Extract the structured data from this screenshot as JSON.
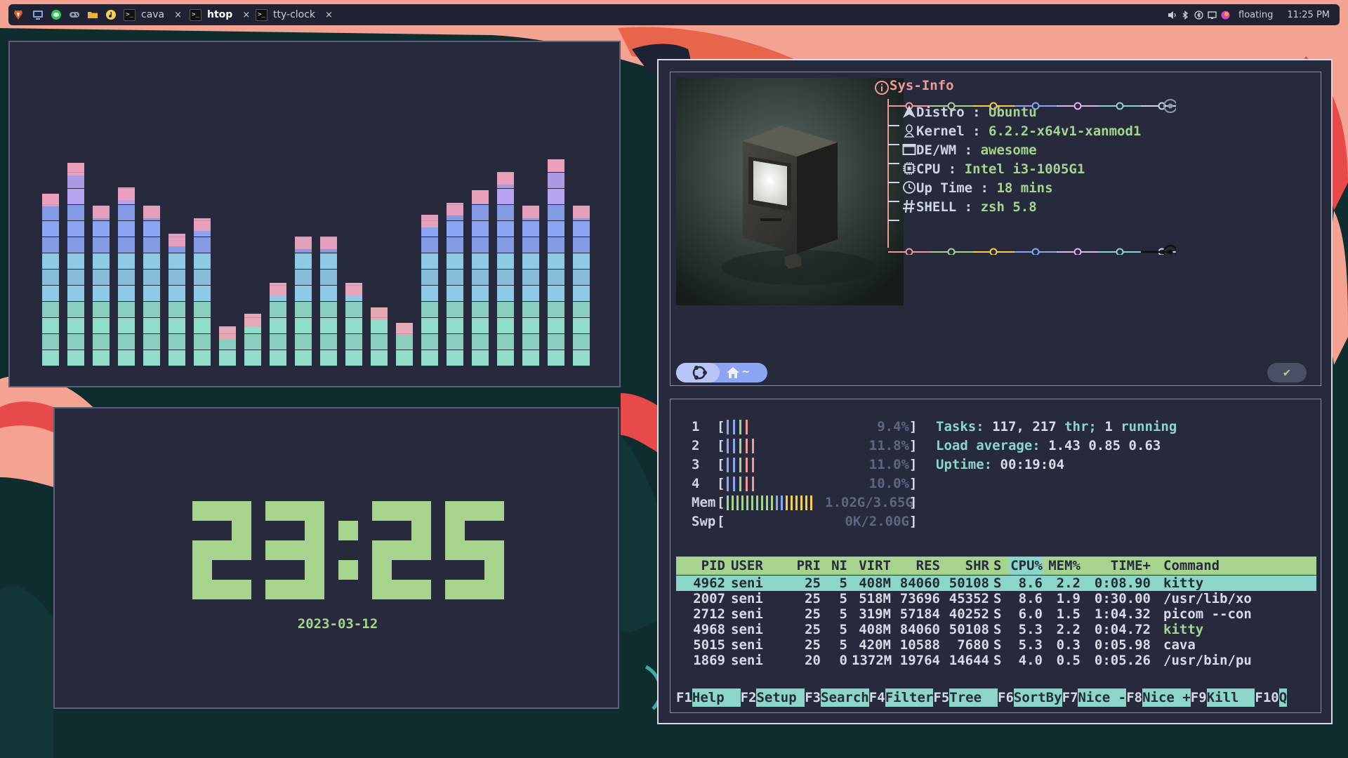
{
  "topbar": {
    "launchers": [
      {
        "icon": "brave-browser-icon",
        "color": "#e4572e"
      },
      {
        "icon": "system-monitor-icon",
        "color": "#8aa3d8"
      },
      {
        "icon": "chat-app-icon",
        "color": "#34c759"
      },
      {
        "icon": "gamepad-icon",
        "color": "#8e96b0"
      },
      {
        "icon": "folder-icon",
        "color": "#f2b233"
      },
      {
        "icon": "music-player-icon",
        "color": "#f5d04a"
      }
    ],
    "tabs": [
      {
        "label": "cava",
        "close": "×",
        "active": false
      },
      {
        "label": "htop",
        "close": "×",
        "active": true
      },
      {
        "label": "tty-clock",
        "close": "×",
        "active": false
      }
    ],
    "tray": {
      "layout": "floating",
      "time": "11:25 PM"
    }
  },
  "cava": {
    "bar_levels": [
      0.56,
      0.66,
      0.52,
      0.58,
      0.52,
      0.43,
      0.48,
      0.13,
      0.17,
      0.27,
      0.42,
      0.42,
      0.27,
      0.19,
      0.14,
      0.49,
      0.53,
      0.57,
      0.63,
      0.52,
      0.67,
      0.52
    ],
    "gradient": [
      "#f4a0b4",
      "#e3b4f0",
      "#b6a4f2",
      "#8ba4f4",
      "#8ec9e6",
      "#91dcca"
    ]
  },
  "clock": {
    "time": "23:25",
    "date": "2023-03-12",
    "digit_color": "#a6d48f"
  },
  "sysinfo": {
    "title": "Sys-Info",
    "rows": [
      {
        "icon": "arch-arrow-icon",
        "label": "Distro",
        "value": "Ubuntu"
      },
      {
        "icon": "linux-penguin-icon",
        "label": "Kernel",
        "value": "6.2.2-x64v1-xanmod1"
      },
      {
        "icon": "window-icon",
        "label": "DE/WM",
        "value": "awesome"
      },
      {
        "icon": "cpu-chip-icon",
        "label": "CPU",
        "value": "Intel i3-1005G1"
      },
      {
        "icon": "clock-icon",
        "label": "Up Time",
        "value": "18 mins"
      },
      {
        "icon": "hash-icon",
        "label": "SHELL",
        "value": "zsh 5.8"
      }
    ],
    "separator": ":",
    "dot_colors": [
      "#f19898",
      "#a6d48f",
      "#f5d04a",
      "#8ba4f4",
      "#e3b4f0",
      "#8bd5ca",
      "#cfd3e6"
    ]
  },
  "prompt": {
    "path": "~",
    "ok": "✔"
  },
  "htop": {
    "cpus": [
      {
        "id": "1",
        "percent": "9.4%",
        "bars": [
          "#8ba4f4",
          "#8ba4f4",
          "#a6d48f",
          "#f19898"
        ]
      },
      {
        "id": "2",
        "percent": "11.8%",
        "bars": [
          "#8ba4f4",
          "#8ba4f4",
          "#a6d48f",
          "#f19898",
          "#f19898"
        ]
      },
      {
        "id": "3",
        "percent": "11.0%",
        "bars": [
          "#8ba4f4",
          "#8ba4f4",
          "#a6d48f",
          "#f19898",
          "#f19898"
        ]
      },
      {
        "id": "4",
        "percent": "10.0%",
        "bars": [
          "#8ba4f4",
          "#8ba4f4",
          "#a6d48f",
          "#f19898",
          "#f19898"
        ]
      }
    ],
    "mem": {
      "label": "Mem",
      "value": "1.02G/3.65G",
      "bars": 18
    },
    "swp": {
      "label": "Swp",
      "value": "0K/2.00G"
    },
    "open_bracket": "[",
    "close_bracket": "]",
    "tasks_label": "Tasks:",
    "tasks_value": "117,",
    "threads_value": "217",
    "threads_label": "thr;",
    "running_value": "1",
    "running_label": "running",
    "load_label": "Load average:",
    "load_values": "1.43 0.85 0.63",
    "uptime_label": "Uptime:",
    "uptime_value": "00:19:04",
    "columns": {
      "pid": "PID",
      "user": "USER",
      "pri": "PRI",
      "ni": "NI",
      "virt": "VIRT",
      "res": "RES",
      "shr": "SHR",
      "s": "S",
      "cpu": "CPU%",
      "mem": "MEM%",
      "time": "TIME+",
      "cmd": "Command"
    },
    "processes": [
      {
        "pid": "4962",
        "user": "seni",
        "pri": "25",
        "ni": "5",
        "virt": "408M",
        "res": "84060",
        "shr": "50108",
        "s": "S",
        "cpu": "8.6",
        "mem": "2.2",
        "time": "0:08.90",
        "cmd": "kitty"
      },
      {
        "pid": "2007",
        "user": "seni",
        "pri": "25",
        "ni": "5",
        "virt": "518M",
        "res": "73696",
        "shr": "45352",
        "s": "S",
        "cpu": "8.6",
        "mem": "1.9",
        "time": "0:30.00",
        "cmd": "/usr/lib/xo"
      },
      {
        "pid": "2712",
        "user": "seni",
        "pri": "25",
        "ni": "5",
        "virt": "319M",
        "res": "57184",
        "shr": "40252",
        "s": "S",
        "cpu": "6.0",
        "mem": "1.5",
        "time": "1:04.32",
        "cmd": "picom --con"
      },
      {
        "pid": "4968",
        "user": "seni",
        "pri": "25",
        "ni": "5",
        "virt": "408M",
        "res": "84060",
        "shr": "50108",
        "s": "S",
        "cpu": "5.3",
        "mem": "2.2",
        "time": "0:04.72",
        "cmd": "kitty"
      },
      {
        "pid": "5015",
        "user": "seni",
        "pri": "25",
        "ni": "5",
        "virt": "420M",
        "res": "10588",
        "shr": "7680",
        "s": "S",
        "cpu": "5.3",
        "mem": "0.3",
        "time": "0:05.98",
        "cmd": "cava"
      },
      {
        "pid": "1869",
        "user": "seni",
        "pri": "20",
        "ni": "0",
        "virt": "1372M",
        "res": "19764",
        "shr": "14644",
        "s": "S",
        "cpu": "4.0",
        "mem": "0.5",
        "time": "0:05.26",
        "cmd": "/usr/bin/pu"
      }
    ],
    "fkeys": [
      {
        "key": "F1",
        "label": "Help  "
      },
      {
        "key": "F2",
        "label": "Setup "
      },
      {
        "key": "F3",
        "label": "Search"
      },
      {
        "key": "F4",
        "label": "Filter"
      },
      {
        "key": "F5",
        "label": "Tree  "
      },
      {
        "key": "F6",
        "label": "SortBy"
      },
      {
        "key": "F7",
        "label": "Nice -"
      },
      {
        "key": "F8",
        "label": "Nice +"
      },
      {
        "key": "F9",
        "label": "Kill  "
      },
      {
        "key": "F10",
        "label": "Q"
      }
    ]
  }
}
